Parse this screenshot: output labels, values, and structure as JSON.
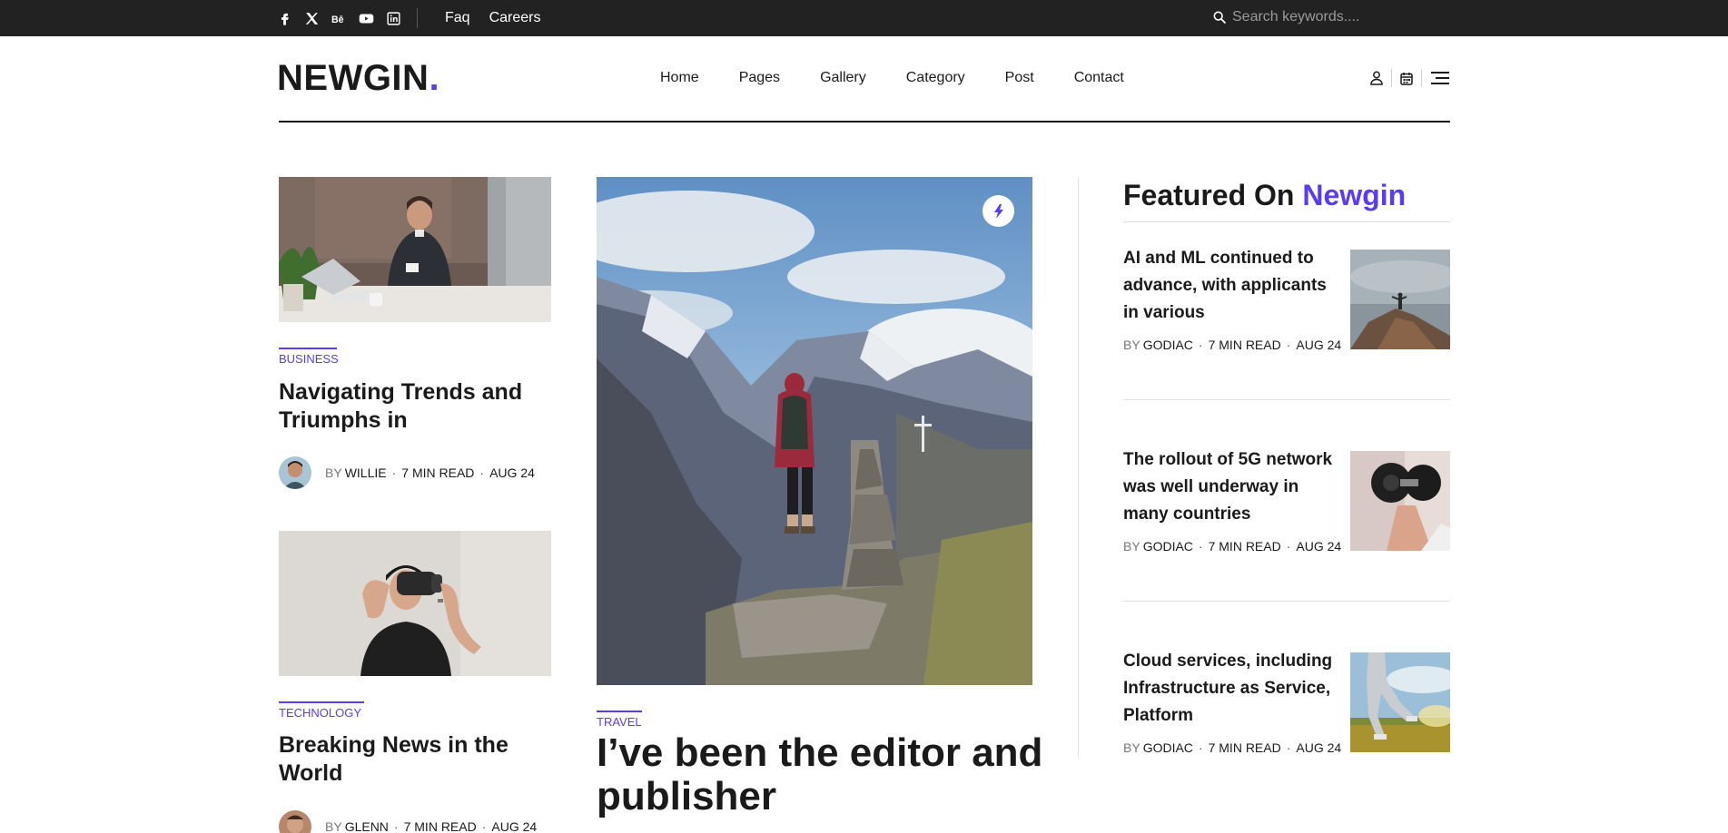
{
  "topbar": {
    "social_icons": [
      "facebook-icon",
      "x-icon",
      "behance-icon",
      "youtube-icon",
      "linkedin-icon"
    ],
    "links": [
      "Faq",
      "Careers"
    ],
    "search_placeholder": "Search keywords...."
  },
  "header": {
    "logo_text": "NEWGIN",
    "logo_dot": ".",
    "nav": [
      "Home",
      "Pages",
      "Gallery",
      "Category",
      "Post",
      "Contact"
    ],
    "icons": [
      "user-icon",
      "calendar-icon",
      "menu-icon"
    ]
  },
  "left_posts": [
    {
      "category": "BUSINESS",
      "title": "Navigating Trends and Triumphs in",
      "by": "BY",
      "author": "WILLIE",
      "read": "7 MIN READ",
      "date": "AUG 24"
    },
    {
      "category": "TECHNOLOGY",
      "title": "Breaking News in the World",
      "by": "BY",
      "author": "GLENN",
      "read": "7 MIN READ",
      "date": "AUG 24"
    }
  ],
  "hero": {
    "category": "TRAVEL",
    "title": "I’ve been the editor and publisher",
    "badge_icon": "flash-icon"
  },
  "featured": {
    "heading_prefix": "Featured On",
    "heading_accent": "Newgin",
    "items": [
      {
        "title": "AI and ML continued to advance, with applicants in various",
        "by": "BY",
        "author": "GODIAC",
        "read": "7 MIN READ",
        "date": "AUG 24"
      },
      {
        "title": "The rollout of 5G network was well underway in many countries",
        "by": "BY",
        "author": "GODIAC",
        "read": "7 MIN READ",
        "date": "AUG 24"
      },
      {
        "title": "Cloud services, including Infrastructure as Service, Platform",
        "by": "BY",
        "author": "GODIAC",
        "read": "7 MIN READ",
        "date": "AUG 24"
      }
    ]
  },
  "colors": {
    "accent": "#5a3bf2",
    "topbar": "#222222",
    "text": "#1a1a1a"
  }
}
